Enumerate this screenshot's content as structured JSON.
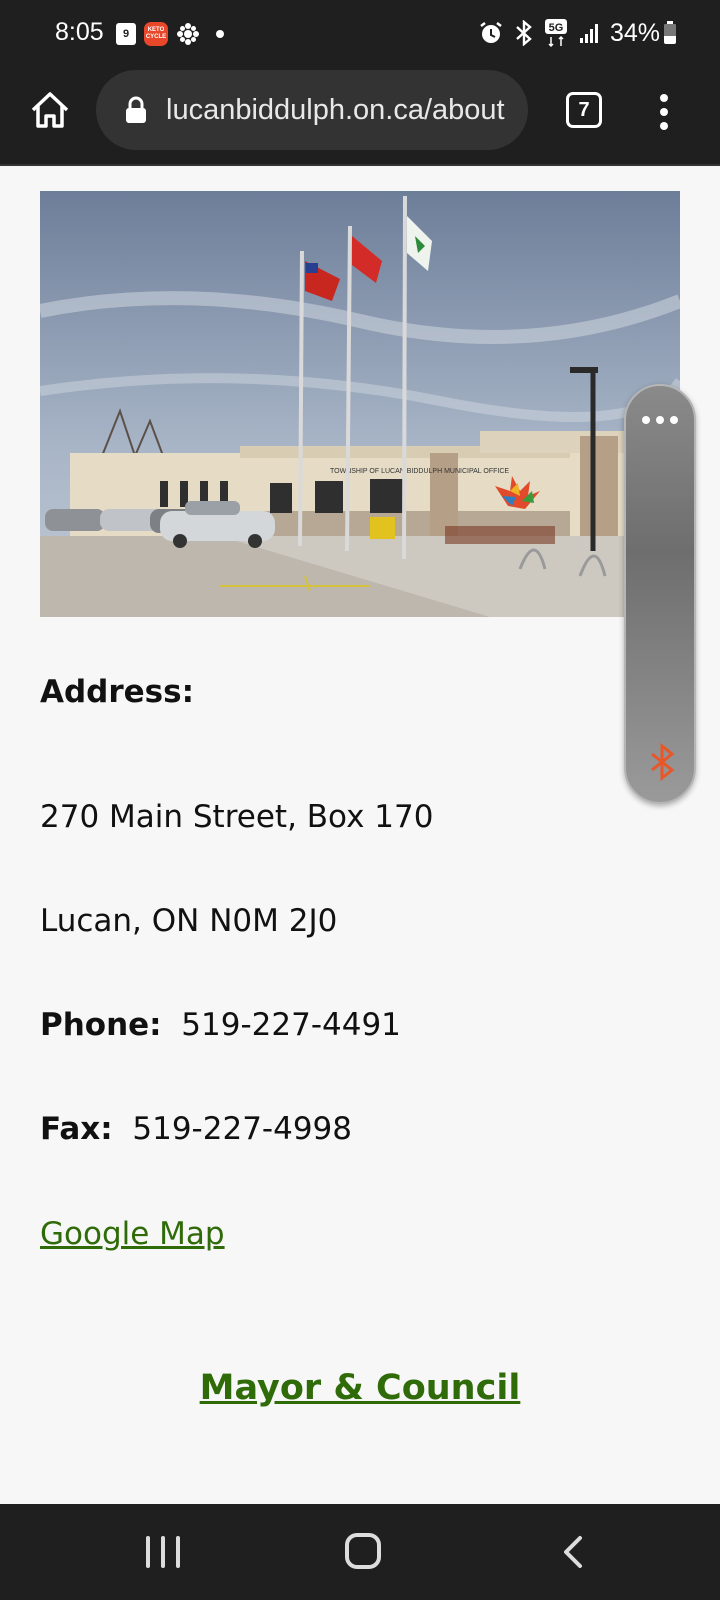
{
  "status_bar": {
    "time": "8:05",
    "calendar_day": "9",
    "app_badge": "KETO CYCLE",
    "battery": "34%",
    "network": "5G"
  },
  "browser": {
    "url": "lucanbiddulph.on.ca/about",
    "tab_count": "7"
  },
  "photo": {
    "sign_text": "TOWNSHIP OF LUCAN BIDDULPH MUNICIPAL OFFICE"
  },
  "contact": {
    "address_label": "Address:",
    "address_line1": "270 Main Street, Box 170",
    "address_line2": "Lucan, ON  N0M 2J0",
    "phone_label": "Phone:",
    "phone_value": "519-227-4491",
    "fax_label": "Fax:",
    "fax_value": "519-227-4998",
    "map_link": "Google Map"
  },
  "links": {
    "mayor_council": "Mayor & Council"
  },
  "colors": {
    "link_green": "#2f6b08",
    "bluetooth_orange": "#e8572a",
    "chrome_dark": "#1f1f1f"
  }
}
